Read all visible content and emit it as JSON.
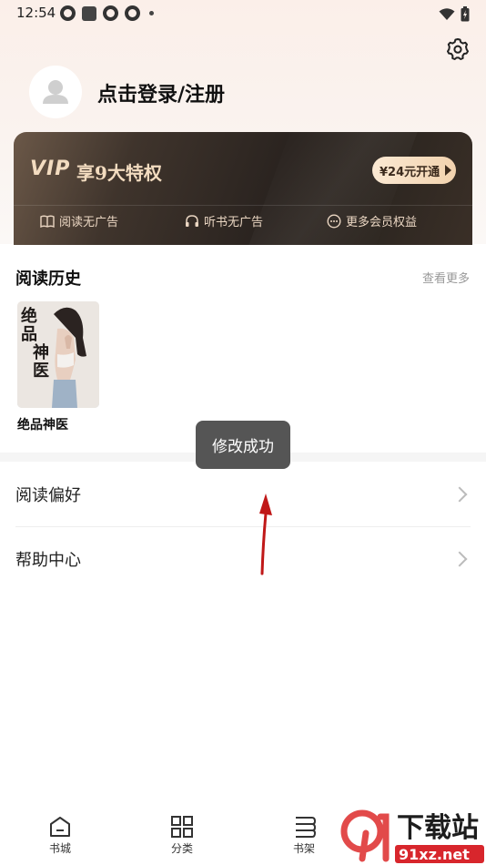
{
  "status_bar": {
    "time": "12:54"
  },
  "profile": {
    "login_label": "点击登录/注册"
  },
  "vip": {
    "logo": "VIP",
    "title": "享9大特权",
    "cta": "¥24元开通",
    "perks": [
      {
        "label": "阅读无广告",
        "icon": "book-icon"
      },
      {
        "label": "听书无广告",
        "icon": "headphones-icon"
      },
      {
        "label": "更多会员权益",
        "icon": "more-icon"
      }
    ]
  },
  "history": {
    "title": "阅读历史",
    "see_more": "查看更多",
    "books": [
      {
        "title": "绝品神医",
        "cover_title": "绝品神医"
      }
    ]
  },
  "menu": [
    {
      "label": "阅读偏好"
    },
    {
      "label": "帮助中心"
    }
  ],
  "toast": "修改成功",
  "bottom_nav": [
    {
      "label": "书城",
      "icon": "home-icon"
    },
    {
      "label": "分类",
      "icon": "grid-icon"
    },
    {
      "label": "书架",
      "icon": "bookshelf-icon"
    }
  ],
  "watermark": {
    "brand": "下载站",
    "domain": "91xz.net"
  }
}
